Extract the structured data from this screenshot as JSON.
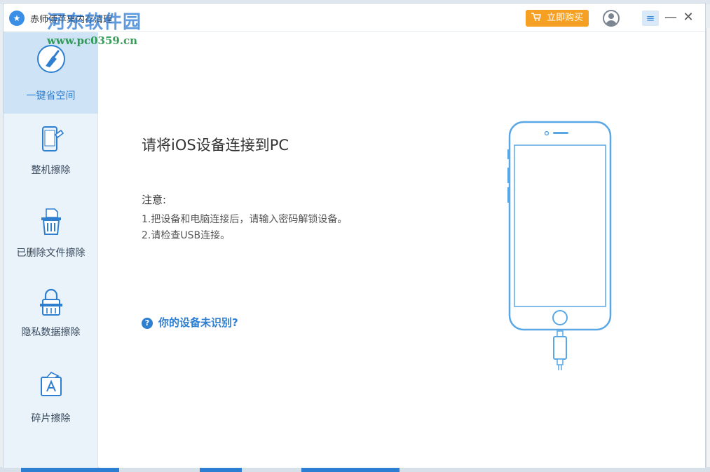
{
  "window": {
    "title": "赤师傅苹果内存清理",
    "watermark_name": "河东软件园",
    "watermark_url": "www.pc0359.cn"
  },
  "titlebar": {
    "buy_label": "立即购买",
    "buy_icon": "cart-icon",
    "user_icon": "user-icon",
    "menu_icon": "menu-icon",
    "minimize_icon": "minimize-icon",
    "close_icon": "close-icon"
  },
  "sidebar": {
    "items": [
      {
        "label": "一键省空间",
        "icon": "broom-icon",
        "active": true
      },
      {
        "label": "整机擦除",
        "icon": "phone-erase-icon",
        "active": false
      },
      {
        "label": "已删除文件擦除",
        "icon": "trash-icon",
        "active": false
      },
      {
        "label": "隐私数据擦除",
        "icon": "lock-icon",
        "active": false
      },
      {
        "label": "碎片擦除",
        "icon": "app-fragment-icon",
        "active": false
      }
    ]
  },
  "main": {
    "title": "请将iOS设备连接到PC",
    "note_heading": "注意:",
    "notes": [
      "1.把设备和电脑连接后，请输入密码解锁设备。",
      "2.请检查USB连接。"
    ],
    "help_link": "你的设备未识别?",
    "illustration_icon": "iphone-cable-icon"
  },
  "colors": {
    "accent": "#2f7fd1",
    "buy_button": "#f5a023",
    "sidebar_bg": "#eaf2fa",
    "sidebar_active": "#cfe3f7"
  }
}
